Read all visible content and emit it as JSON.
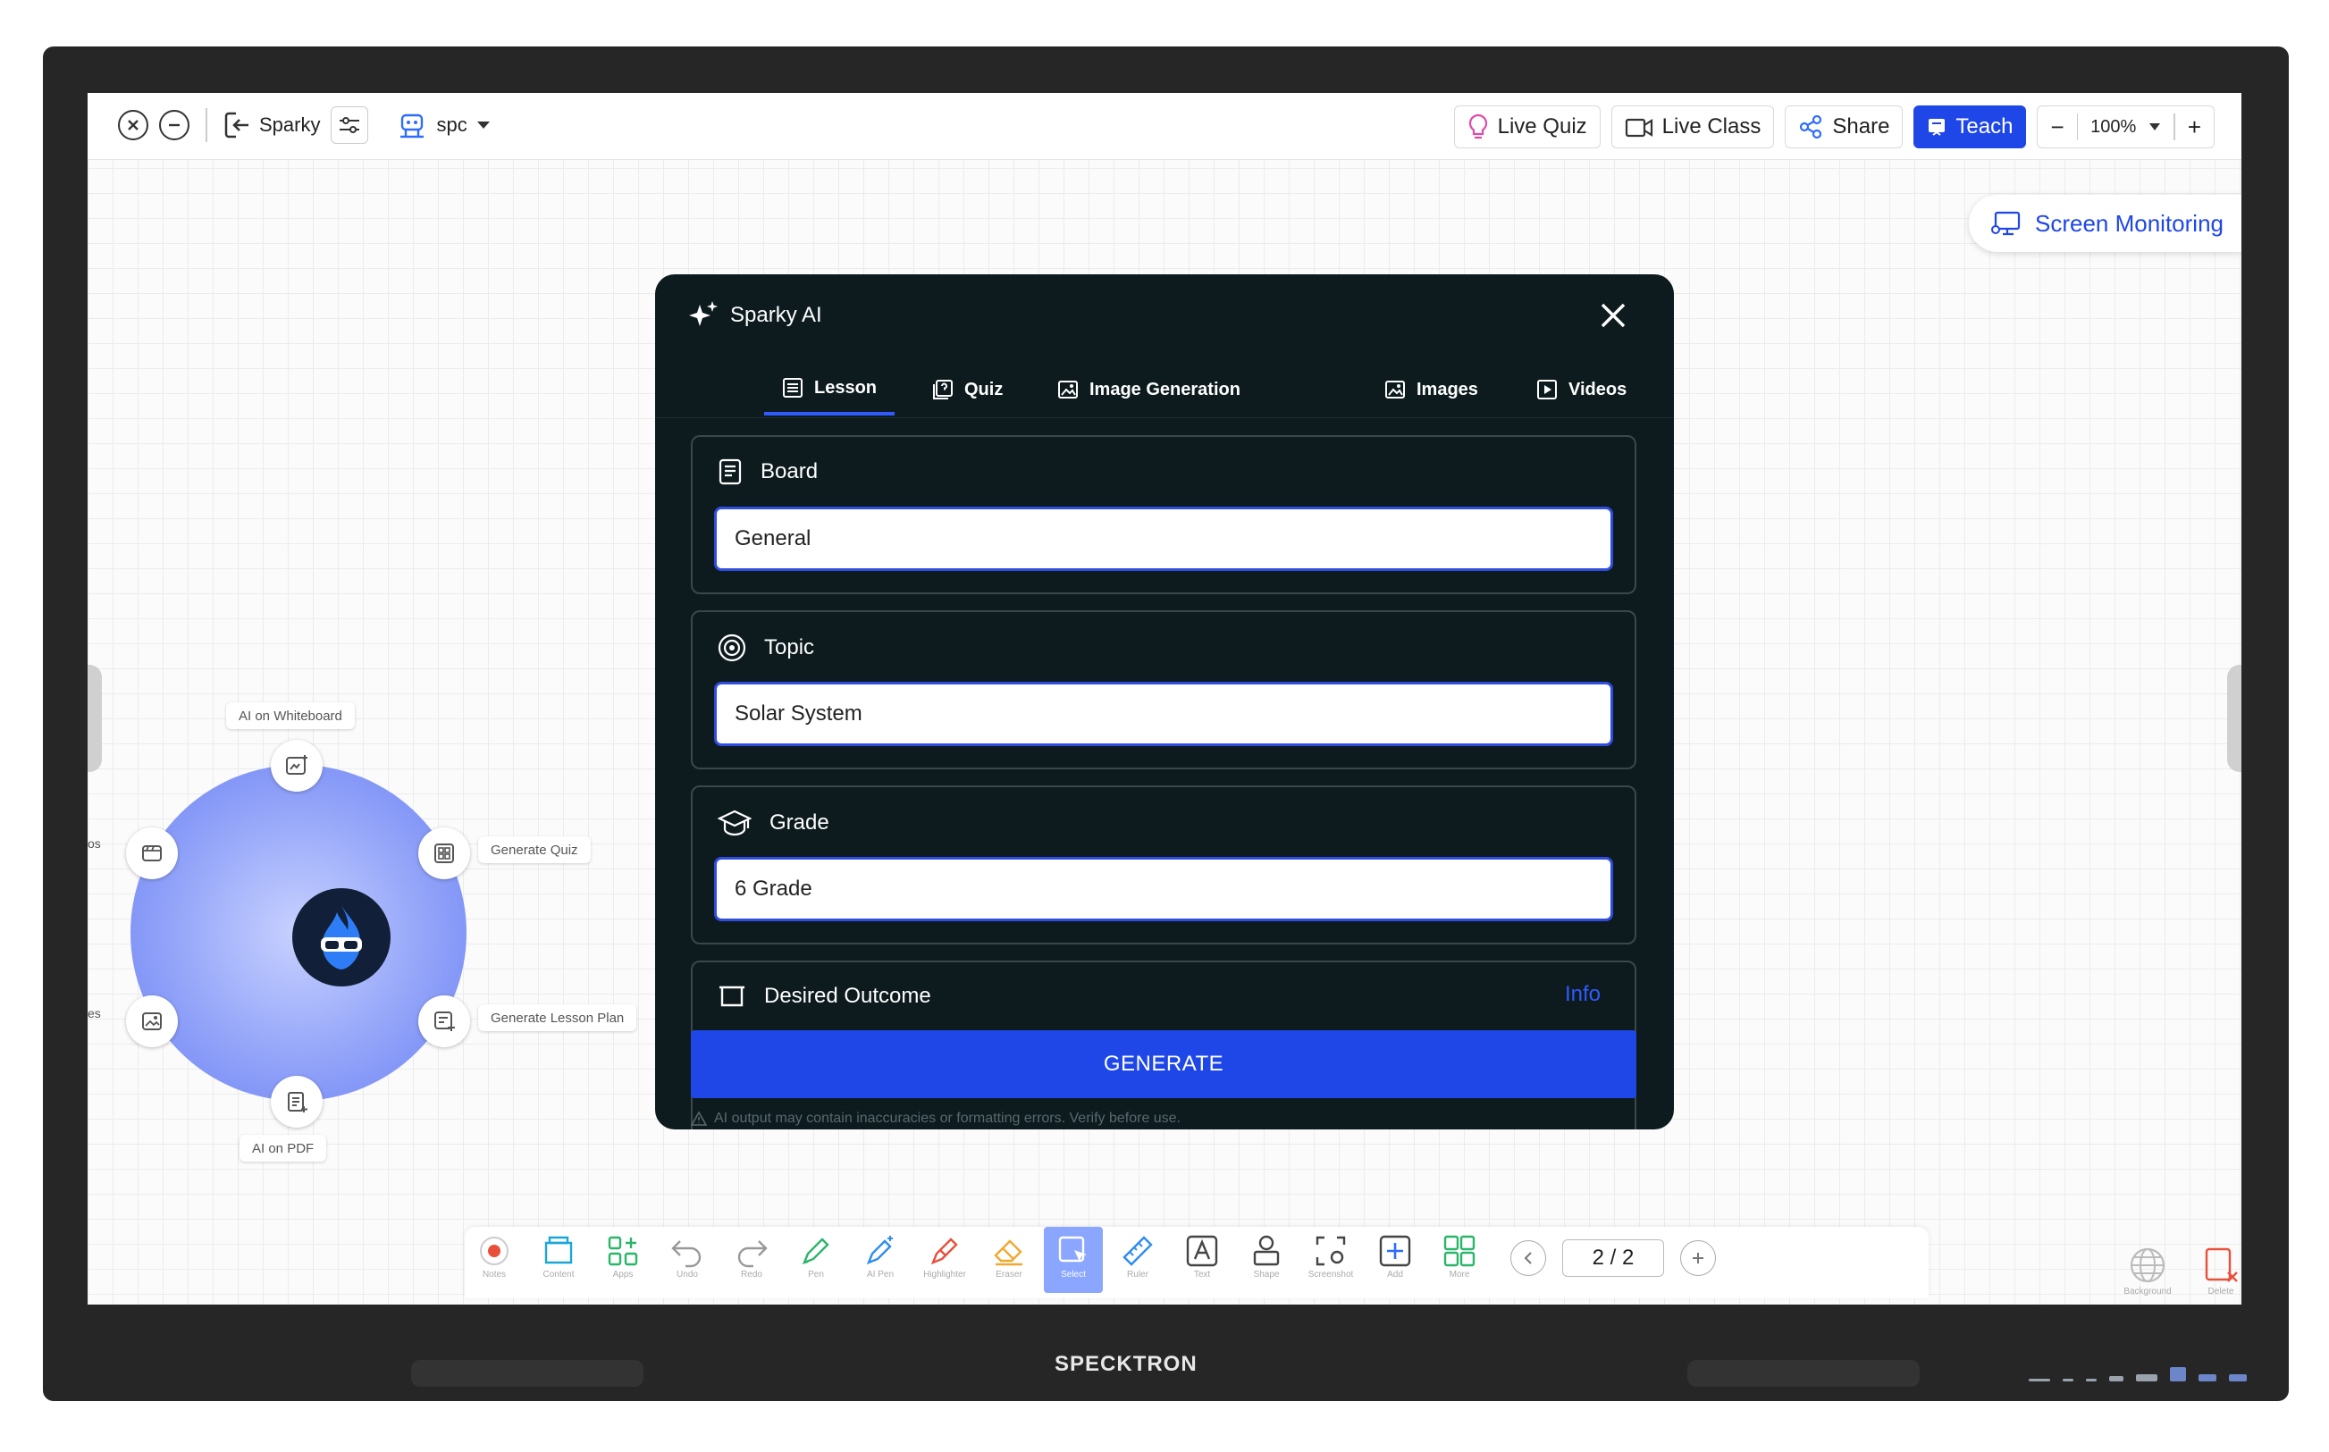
{
  "device": {
    "brand": "SPECKTRON"
  },
  "topbar": {
    "app_name": "Sparky",
    "user": "spc",
    "live_quiz": "Live Quiz",
    "live_class": "Live Class",
    "share": "Share",
    "teach": "Teach",
    "zoom_level": "100%"
  },
  "screen_monitoring": "Screen Monitoring",
  "wheel": {
    "labels": {
      "top": "AI on Whiteboard",
      "right_upper": "Generate Quiz",
      "right_lower": "Generate Lesson Plan",
      "bottom": "AI on PDF",
      "left_upper": "os",
      "left_lower": "es"
    }
  },
  "modal": {
    "title": "Sparky AI",
    "tabs": [
      {
        "label": "Lesson",
        "icon": "list-icon",
        "active": true
      },
      {
        "label": "Quiz",
        "icon": "quiz-icon",
        "active": false
      },
      {
        "label": "Image Generation",
        "icon": "image-icon",
        "active": false
      },
      {
        "label": "Images",
        "icon": "images-icon",
        "active": false
      },
      {
        "label": "Videos",
        "icon": "play-icon",
        "active": false
      }
    ],
    "fields": {
      "board": {
        "label": "Board",
        "value": "General"
      },
      "topic": {
        "label": "Topic",
        "value": "Solar System"
      },
      "grade": {
        "label": "Grade",
        "value": "6 Grade"
      },
      "desired_outcome": {
        "label": "Desired Outcome",
        "info": "Info"
      }
    },
    "generate": "GENERATE",
    "disclaimer": "AI output may contain inaccuracies or formatting errors. Verify before use."
  },
  "toolbar": {
    "tools": [
      {
        "label": "Notes",
        "icon": "record-icon"
      },
      {
        "label": "Content",
        "icon": "folder-icon"
      },
      {
        "label": "Apps",
        "icon": "apps-add-icon"
      },
      {
        "label": "Undo",
        "icon": "undo-icon"
      },
      {
        "label": "Redo",
        "icon": "redo-icon"
      },
      {
        "label": "Pen",
        "icon": "pen-icon"
      },
      {
        "label": "AI Pen",
        "icon": "ai-pen-icon"
      },
      {
        "label": "Highlighter",
        "icon": "highlighter-icon"
      },
      {
        "label": "Eraser",
        "icon": "eraser-icon"
      },
      {
        "label": "Select",
        "icon": "select-icon"
      },
      {
        "label": "Ruler",
        "icon": "ruler-icon"
      },
      {
        "label": "Text",
        "icon": "text-icon"
      },
      {
        "label": "Shape",
        "icon": "shape-icon"
      },
      {
        "label": "Screenshot",
        "icon": "screenshot-icon"
      },
      {
        "label": "Add",
        "icon": "add-icon"
      },
      {
        "label": "More",
        "icon": "grid-icon"
      }
    ],
    "page": "2 / 2",
    "background_label": "Background",
    "delete_label": "Delete"
  },
  "colors": {
    "accent": "#1f47e8",
    "modal_bg": "#0d1b1f"
  }
}
